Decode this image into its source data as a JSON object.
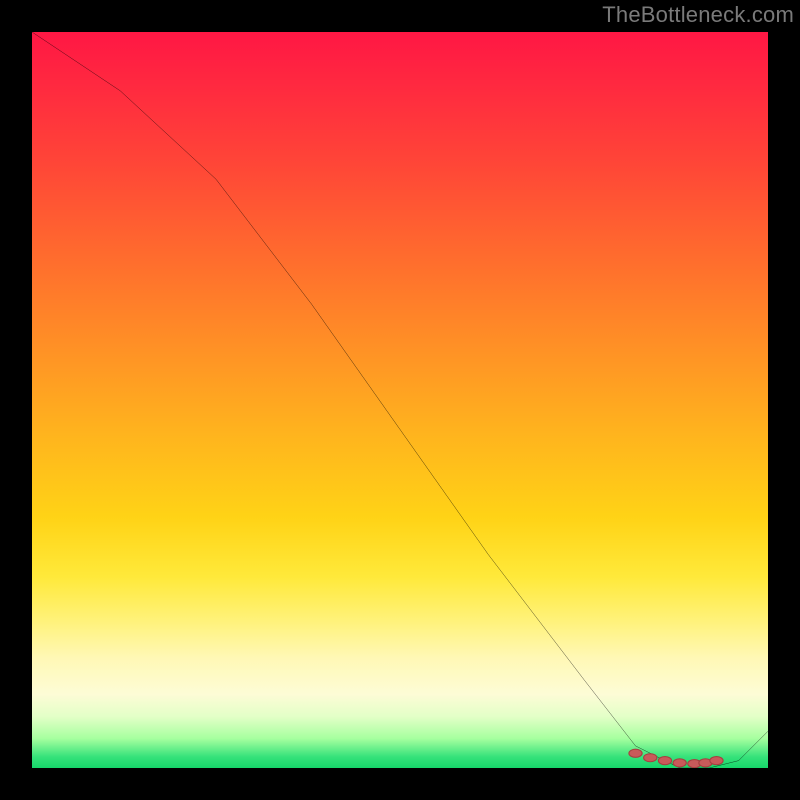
{
  "watermark": "TheBottleneck.com",
  "chart_data": {
    "type": "line",
    "title": "",
    "xlabel": "",
    "ylabel": "",
    "xlim": [
      0,
      100
    ],
    "ylim": [
      0,
      100
    ],
    "x": [
      0,
      12,
      25,
      38,
      50,
      62,
      75,
      82,
      88,
      92,
      96,
      100
    ],
    "values": [
      100,
      92,
      80,
      63,
      46,
      29,
      12,
      3,
      0,
      0,
      1,
      5
    ],
    "markers_x": [
      82,
      84,
      86,
      88,
      90,
      91.5,
      93
    ],
    "markers_y": [
      2,
      1.4,
      1,
      0.7,
      0.6,
      0.7,
      1
    ],
    "annotations": []
  },
  "colors": {
    "curve": "#000000",
    "marker": "#c85a5a",
    "marker_edge": "#a64040",
    "background_frame": "#000000"
  }
}
